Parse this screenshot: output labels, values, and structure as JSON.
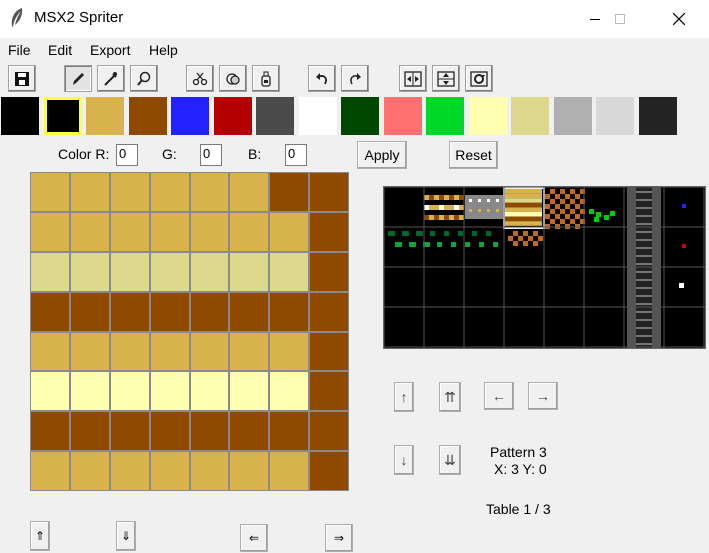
{
  "window": {
    "title": "MSX2 Spriter",
    "minimize": "—",
    "maximize": "☐",
    "close": "✕"
  },
  "menu": [
    "File",
    "Edit",
    "Export",
    "Help"
  ],
  "toolbar": {
    "tools": [
      {
        "name": "save-icon",
        "glyph": "💾"
      },
      {
        "name": "pencil-icon",
        "glyph": "✎"
      },
      {
        "name": "eyedropper-icon",
        "glyph": "⚗"
      },
      {
        "name": "magnifier-icon",
        "glyph": "🔍"
      },
      {
        "name": "scissors-icon",
        "glyph": "✂"
      },
      {
        "name": "copy-stamp-icon",
        "glyph": "⧉"
      },
      {
        "name": "paste-bottle-icon",
        "glyph": "♙"
      },
      {
        "name": "undo-icon",
        "glyph": "↶"
      },
      {
        "name": "redo-icon",
        "glyph": "↷"
      },
      {
        "name": "flip-horizontal-icon",
        "glyph": "⇔"
      },
      {
        "name": "flip-vertical-icon",
        "glyph": "⇕"
      },
      {
        "name": "rotate-icon",
        "glyph": "⟳"
      }
    ]
  },
  "palette": [
    "#000000",
    "#000000",
    "#d8b24c",
    "#8f4a00",
    "#2222ff",
    "#b40000",
    "#4a4a4a",
    "#ffffff",
    "#004800",
    "#ff7070",
    "#00d828",
    "#ffffb0",
    "#dcd88c",
    "#b0b0b0",
    "#d8d8d8",
    "#242424"
  ],
  "palette_selected_index": 1,
  "color_editor": {
    "r_label": "Color R:",
    "r": "0",
    "g_label": "G:",
    "g": "0",
    "b_label": "B:",
    "b": "0",
    "apply": "Apply",
    "reset": "Reset"
  },
  "editor_colors": {
    "gold": "#d8b24c",
    "brown": "#8f4a00",
    "pale": "#dcd88c",
    "cream": "#ffffb0"
  },
  "editor_rows": [
    [
      "gold",
      "gold",
      "gold",
      "gold",
      "gold",
      "gold",
      "brown",
      "brown"
    ],
    [
      "gold",
      "gold",
      "gold",
      "gold",
      "gold",
      "gold",
      "gold",
      "brown"
    ],
    [
      "pale",
      "pale",
      "pale",
      "pale",
      "pale",
      "pale",
      "pale",
      "brown"
    ],
    [
      "brown",
      "brown",
      "brown",
      "brown",
      "brown",
      "brown",
      "brown",
      "brown"
    ],
    [
      "gold",
      "gold",
      "gold",
      "gold",
      "gold",
      "gold",
      "gold",
      "brown"
    ],
    [
      "cream",
      "cream",
      "cream",
      "cream",
      "cream",
      "cream",
      "cream",
      "brown"
    ],
    [
      "brown",
      "brown",
      "brown",
      "brown",
      "brown",
      "brown",
      "brown",
      "brown"
    ],
    [
      "gold",
      "gold",
      "gold",
      "gold",
      "gold",
      "gold",
      "gold",
      "brown"
    ]
  ],
  "editor_shift": {
    "up": "⇑",
    "down": "⇓",
    "left": "⇐",
    "right": "⇒"
  },
  "pattern_nav": {
    "up": "↑",
    "up_fast": "⇈",
    "left": "←",
    "right": "→",
    "down": "↓",
    "down_fast": "⇊"
  },
  "status": {
    "pattern": "Pattern 3",
    "coords": "X: 3 Y: 0",
    "table": "Table 1 / 3"
  }
}
